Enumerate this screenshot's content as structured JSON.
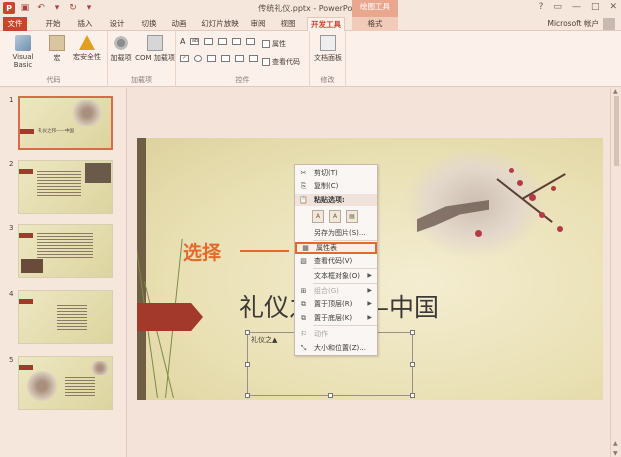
{
  "titlebar": {
    "title": "传统礼仪.pptx - PowerPoint",
    "context_tab_header": "绘图工具",
    "help": "?",
    "restore": "▭",
    "minimize": "—",
    "maximize": "□",
    "close": "✕"
  },
  "tabs": {
    "file": "文件",
    "items": [
      "开始",
      "插入",
      "设计",
      "切换",
      "动画",
      "幻灯片放映",
      "审阅",
      "视图",
      "开发工具",
      "格式"
    ],
    "account": "Microsoft 帐户"
  },
  "ribbon": {
    "groups": {
      "code": "代码",
      "addins": "加载项",
      "controls": "控件",
      "modify": "修改"
    },
    "buttons": {
      "visual_basic": "Visual Basic",
      "macro": "宏",
      "macro_security": "宏安全性",
      "addins": "加载项",
      "com_addins": "COM 加载项",
      "properties": "属性",
      "view_code": "查看代码",
      "document_panel": "文档面板"
    }
  },
  "thumbnails": [
    {
      "num": "1",
      "title": "礼仪之邦——中国"
    },
    {
      "num": "2"
    },
    {
      "num": "3"
    },
    {
      "num": "4"
    },
    {
      "num": "5"
    }
  ],
  "slide": {
    "title": "礼仪之邦——中国",
    "textbox_text": "礼仪之▲"
  },
  "annotation": "选择",
  "context_menu": {
    "cut": "剪切(T)",
    "copy": "复制(C)",
    "paste_header": "粘贴选项:",
    "save_as_picture": "另存为图片(S)...",
    "properties": "属性表",
    "view_code": "查看代码(V)",
    "textbox_object": "文本框对象(O)",
    "group": "组合(G)",
    "bring_to_front": "置于顶层(R)",
    "send_to_back": "置于底层(K)",
    "action": "动作",
    "size_position": "大小和位置(Z)..."
  }
}
